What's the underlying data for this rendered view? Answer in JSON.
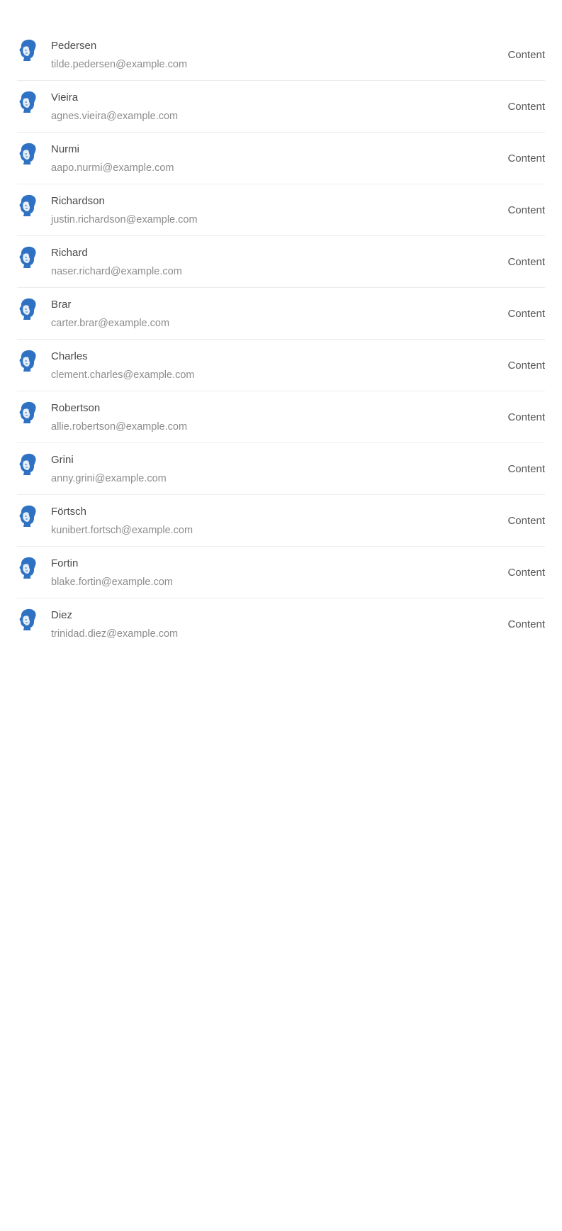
{
  "list": {
    "items": [
      {
        "name": "Pedersen",
        "email": "tilde.pedersen@example.com",
        "action": "Content",
        "avatar_icon": "male-avatar-icon"
      },
      {
        "name": "Vieira",
        "email": "agnes.vieira@example.com",
        "action": "Content",
        "avatar_icon": "male-avatar-icon"
      },
      {
        "name": "Nurmi",
        "email": "aapo.nurmi@example.com",
        "action": "Content",
        "avatar_icon": "male-avatar-icon"
      },
      {
        "name": "Richardson",
        "email": "justin.richardson@example.com",
        "action": "Content",
        "avatar_icon": "male-avatar-icon"
      },
      {
        "name": "Richard",
        "email": "naser.richard@example.com",
        "action": "Content",
        "avatar_icon": "male-avatar-icon"
      },
      {
        "name": "Brar",
        "email": "carter.brar@example.com",
        "action": "Content",
        "avatar_icon": "male-avatar-icon"
      },
      {
        "name": "Charles",
        "email": "clement.charles@example.com",
        "action": "Content",
        "avatar_icon": "male-avatar-icon"
      },
      {
        "name": "Robertson",
        "email": "allie.robertson@example.com",
        "action": "Content",
        "avatar_icon": "male-avatar-icon"
      },
      {
        "name": "Grini",
        "email": "anny.grini@example.com",
        "action": "Content",
        "avatar_icon": "male-avatar-icon"
      },
      {
        "name": "Förtsch",
        "email": "kunibert.fortsch@example.com",
        "action": "Content",
        "avatar_icon": "male-avatar-icon"
      },
      {
        "name": "Fortin",
        "email": "blake.fortin@example.com",
        "action": "Content",
        "avatar_icon": "male-avatar-icon"
      },
      {
        "name": "Diez",
        "email": "trinidad.diez@example.com",
        "action": "Content",
        "avatar_icon": "male-avatar-icon"
      }
    ]
  },
  "colors": {
    "avatar_blue": "#2f72c4",
    "name_text": "#4a4a4a",
    "email_text": "#8c8c8c",
    "divider": "#ececec"
  }
}
